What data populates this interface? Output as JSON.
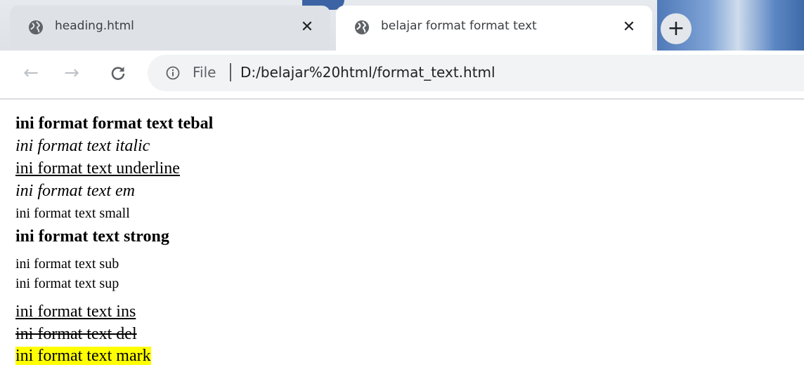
{
  "browser": {
    "tabs": [
      {
        "title": "heading.html",
        "close": "✕",
        "active": false
      },
      {
        "title": "belajar format format text",
        "close": "✕",
        "active": true
      }
    ],
    "new_tab": "+",
    "nav": {
      "back": "←",
      "forward": "→",
      "reload": "C"
    },
    "omnibox": {
      "scheme_label": "File",
      "url": "D:/belajar%20html/format_text.html"
    }
  },
  "content": {
    "bold": "ini format format text tebal",
    "italic": "ini format text italic",
    "underline": "ini format text underline",
    "em": "ini format text em",
    "small": "ini format text small",
    "strong": "ini format text strong",
    "sub": "ini format text sub",
    "sup": "ini format text sup",
    "ins": "ini format text ins",
    "del": "ini format text del",
    "mark": "ini format text mark"
  },
  "colors": {
    "mark_highlight": "#ffff00",
    "tabstrip": "#dee1e6",
    "omnibox": "#f1f3f4"
  },
  "icons": {
    "tab_favicon": "globe-icon",
    "info": "info-icon"
  }
}
